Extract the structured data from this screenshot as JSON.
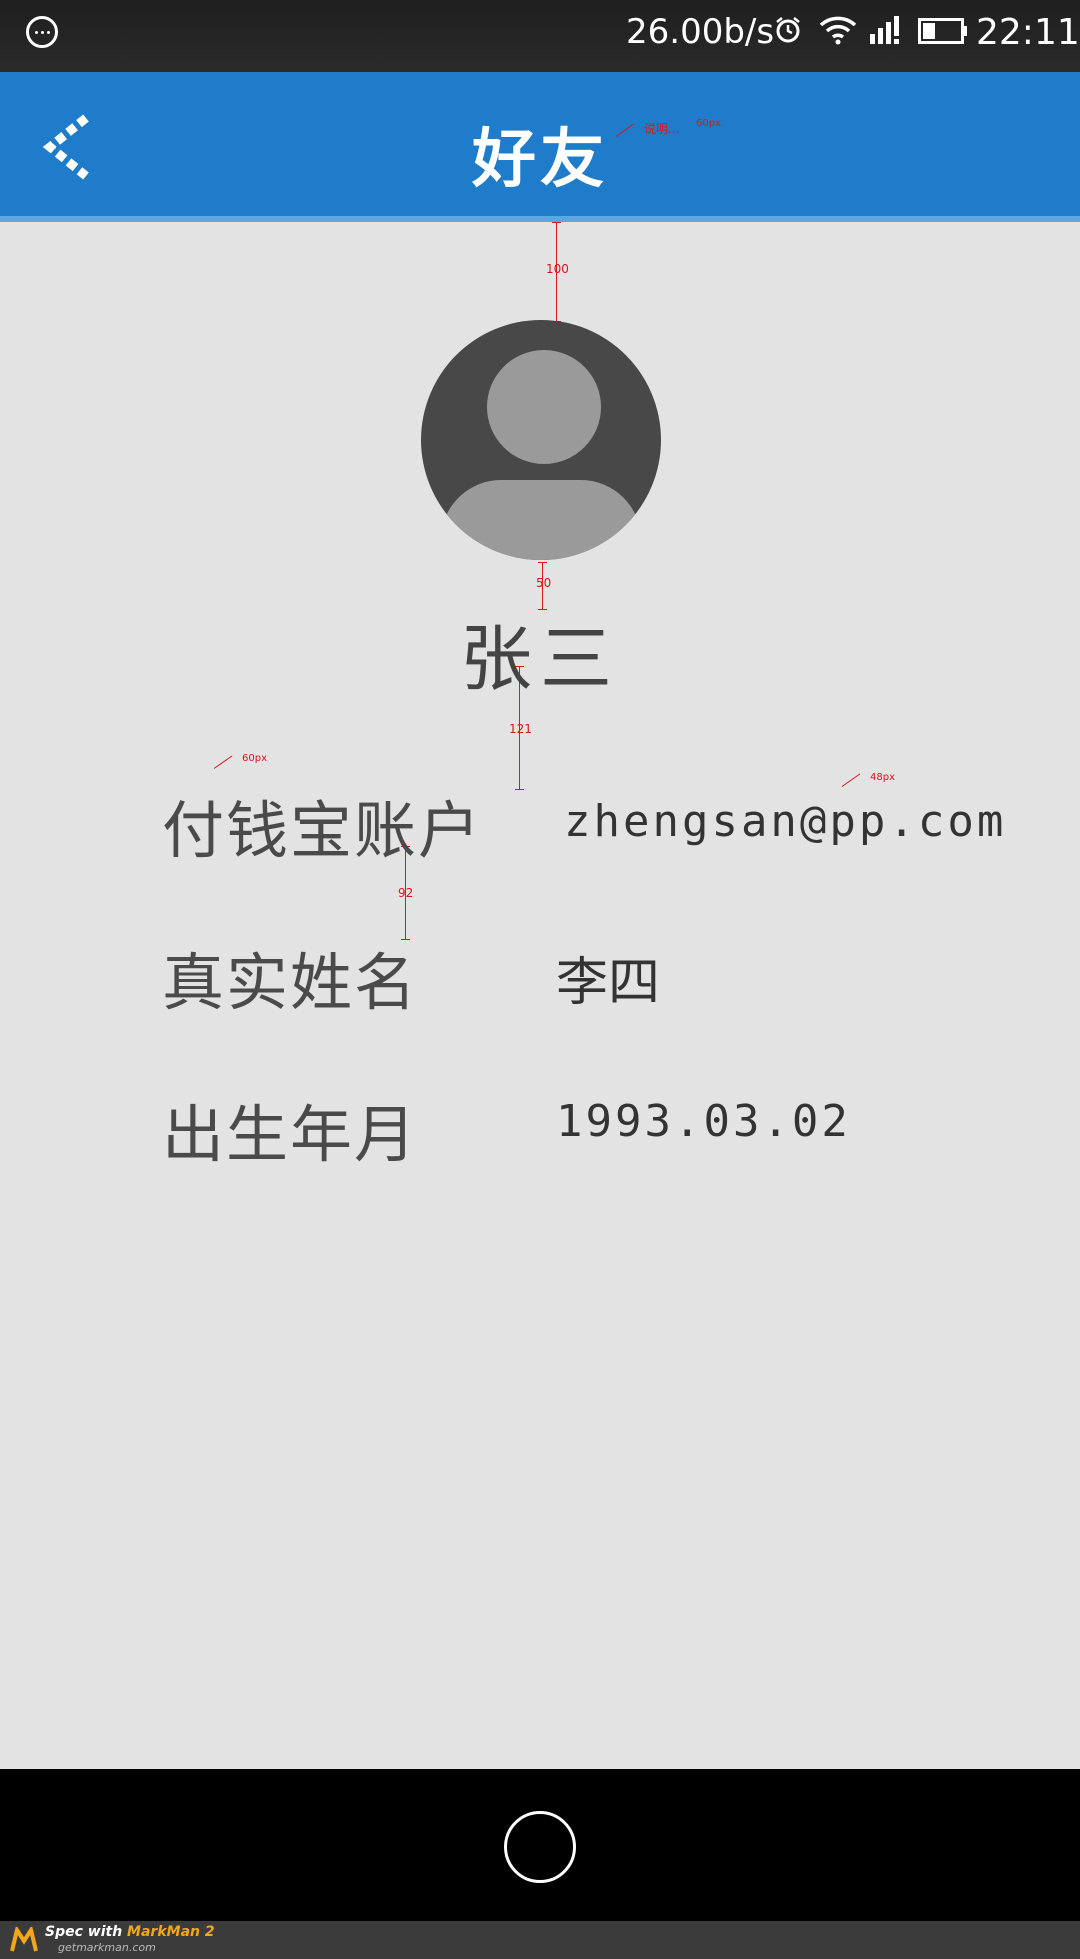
{
  "status_bar": {
    "net_speed": "26.00b/s",
    "time": "22:11",
    "icons": [
      "menu-icon",
      "alarm-icon",
      "wifi-icon",
      "signal-icon",
      "battery-icon"
    ]
  },
  "app_bar": {
    "title": "好友",
    "back_icon": "chevron-left-icon",
    "color": "#1f7ccb"
  },
  "annotations": {
    "title_note": "说明...",
    "title_size": "60px",
    "gap_top_avatar": "100",
    "gap_avatar_name": "50",
    "gap_name_row": "121",
    "label_size": "60px",
    "value_size": "48px",
    "gap_rows": "92"
  },
  "profile": {
    "name": "张三",
    "rows": [
      {
        "label": "付钱宝账户",
        "value": "zhengsan@pp.com"
      },
      {
        "label": "真实姓名",
        "value": "李四"
      },
      {
        "label": "出生年月",
        "value": "1993.03.02"
      }
    ]
  },
  "footer": {
    "spec_with": "Spec with ",
    "brand": "MarkMan 2",
    "site": "getmarkman.com"
  }
}
